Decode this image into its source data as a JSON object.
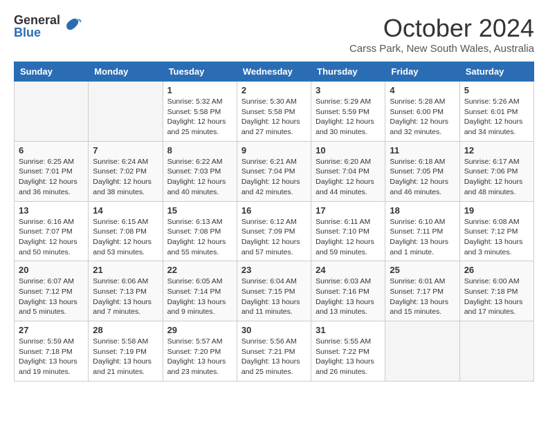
{
  "logo": {
    "general": "General",
    "blue": "Blue"
  },
  "title": "October 2024",
  "subtitle": "Carss Park, New South Wales, Australia",
  "days_header": [
    "Sunday",
    "Monday",
    "Tuesday",
    "Wednesday",
    "Thursday",
    "Friday",
    "Saturday"
  ],
  "weeks": [
    [
      {
        "num": "",
        "content": ""
      },
      {
        "num": "",
        "content": ""
      },
      {
        "num": "1",
        "content": "Sunrise: 5:32 AM\nSunset: 5:58 PM\nDaylight: 12 hours\nand 25 minutes."
      },
      {
        "num": "2",
        "content": "Sunrise: 5:30 AM\nSunset: 5:58 PM\nDaylight: 12 hours\nand 27 minutes."
      },
      {
        "num": "3",
        "content": "Sunrise: 5:29 AM\nSunset: 5:59 PM\nDaylight: 12 hours\nand 30 minutes."
      },
      {
        "num": "4",
        "content": "Sunrise: 5:28 AM\nSunset: 6:00 PM\nDaylight: 12 hours\nand 32 minutes."
      },
      {
        "num": "5",
        "content": "Sunrise: 5:26 AM\nSunset: 6:01 PM\nDaylight: 12 hours\nand 34 minutes."
      }
    ],
    [
      {
        "num": "6",
        "content": "Sunrise: 6:25 AM\nSunset: 7:01 PM\nDaylight: 12 hours\nand 36 minutes."
      },
      {
        "num": "7",
        "content": "Sunrise: 6:24 AM\nSunset: 7:02 PM\nDaylight: 12 hours\nand 38 minutes."
      },
      {
        "num": "8",
        "content": "Sunrise: 6:22 AM\nSunset: 7:03 PM\nDaylight: 12 hours\nand 40 minutes."
      },
      {
        "num": "9",
        "content": "Sunrise: 6:21 AM\nSunset: 7:04 PM\nDaylight: 12 hours\nand 42 minutes."
      },
      {
        "num": "10",
        "content": "Sunrise: 6:20 AM\nSunset: 7:04 PM\nDaylight: 12 hours\nand 44 minutes."
      },
      {
        "num": "11",
        "content": "Sunrise: 6:18 AM\nSunset: 7:05 PM\nDaylight: 12 hours\nand 46 minutes."
      },
      {
        "num": "12",
        "content": "Sunrise: 6:17 AM\nSunset: 7:06 PM\nDaylight: 12 hours\nand 48 minutes."
      }
    ],
    [
      {
        "num": "13",
        "content": "Sunrise: 6:16 AM\nSunset: 7:07 PM\nDaylight: 12 hours\nand 50 minutes."
      },
      {
        "num": "14",
        "content": "Sunrise: 6:15 AM\nSunset: 7:08 PM\nDaylight: 12 hours\nand 53 minutes."
      },
      {
        "num": "15",
        "content": "Sunrise: 6:13 AM\nSunset: 7:08 PM\nDaylight: 12 hours\nand 55 minutes."
      },
      {
        "num": "16",
        "content": "Sunrise: 6:12 AM\nSunset: 7:09 PM\nDaylight: 12 hours\nand 57 minutes."
      },
      {
        "num": "17",
        "content": "Sunrise: 6:11 AM\nSunset: 7:10 PM\nDaylight: 12 hours\nand 59 minutes."
      },
      {
        "num": "18",
        "content": "Sunrise: 6:10 AM\nSunset: 7:11 PM\nDaylight: 13 hours\nand 1 minute."
      },
      {
        "num": "19",
        "content": "Sunrise: 6:08 AM\nSunset: 7:12 PM\nDaylight: 13 hours\nand 3 minutes."
      }
    ],
    [
      {
        "num": "20",
        "content": "Sunrise: 6:07 AM\nSunset: 7:12 PM\nDaylight: 13 hours\nand 5 minutes."
      },
      {
        "num": "21",
        "content": "Sunrise: 6:06 AM\nSunset: 7:13 PM\nDaylight: 13 hours\nand 7 minutes."
      },
      {
        "num": "22",
        "content": "Sunrise: 6:05 AM\nSunset: 7:14 PM\nDaylight: 13 hours\nand 9 minutes."
      },
      {
        "num": "23",
        "content": "Sunrise: 6:04 AM\nSunset: 7:15 PM\nDaylight: 13 hours\nand 11 minutes."
      },
      {
        "num": "24",
        "content": "Sunrise: 6:03 AM\nSunset: 7:16 PM\nDaylight: 13 hours\nand 13 minutes."
      },
      {
        "num": "25",
        "content": "Sunrise: 6:01 AM\nSunset: 7:17 PM\nDaylight: 13 hours\nand 15 minutes."
      },
      {
        "num": "26",
        "content": "Sunrise: 6:00 AM\nSunset: 7:18 PM\nDaylight: 13 hours\nand 17 minutes."
      }
    ],
    [
      {
        "num": "27",
        "content": "Sunrise: 5:59 AM\nSunset: 7:18 PM\nDaylight: 13 hours\nand 19 minutes."
      },
      {
        "num": "28",
        "content": "Sunrise: 5:58 AM\nSunset: 7:19 PM\nDaylight: 13 hours\nand 21 minutes."
      },
      {
        "num": "29",
        "content": "Sunrise: 5:57 AM\nSunset: 7:20 PM\nDaylight: 13 hours\nand 23 minutes."
      },
      {
        "num": "30",
        "content": "Sunrise: 5:56 AM\nSunset: 7:21 PM\nDaylight: 13 hours\nand 25 minutes."
      },
      {
        "num": "31",
        "content": "Sunrise: 5:55 AM\nSunset: 7:22 PM\nDaylight: 13 hours\nand 26 minutes."
      },
      {
        "num": "",
        "content": ""
      },
      {
        "num": "",
        "content": ""
      }
    ]
  ]
}
